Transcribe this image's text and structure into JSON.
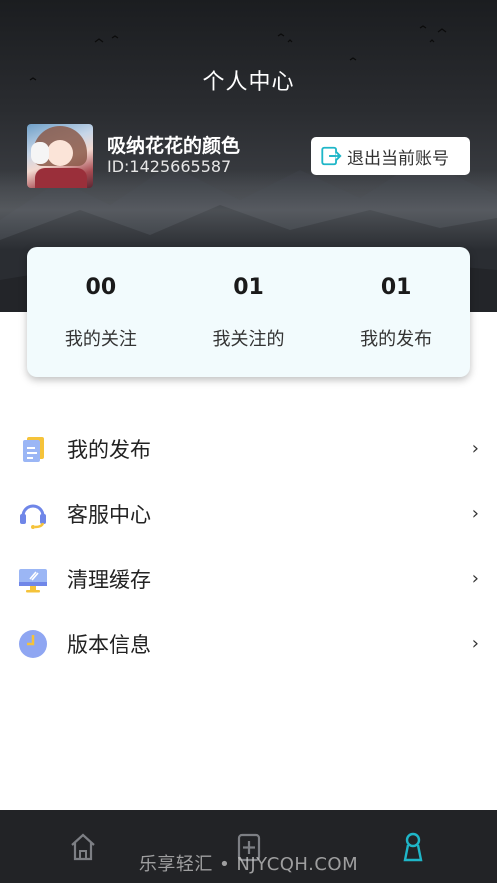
{
  "header": {
    "title": "个人中心"
  },
  "profile": {
    "username": "吸纳花花的颜色",
    "user_id": "ID:1425665587",
    "avatar_icon": "anime-avatar"
  },
  "logout": {
    "label": "退出当前账号",
    "icon": "logout-icon",
    "accent": "#1fb6c8"
  },
  "stats": [
    {
      "value": "00",
      "label": "我的关注"
    },
    {
      "value": "01",
      "label": "我关注的"
    },
    {
      "value": "01",
      "label": "我的发布"
    }
  ],
  "menu": [
    {
      "label": "我的发布",
      "icon": "document-icon"
    },
    {
      "label": "客服中心",
      "icon": "headset-icon"
    },
    {
      "label": "清理缓存",
      "icon": "monitor-icon"
    },
    {
      "label": "版本信息",
      "icon": "clock-icon"
    }
  ],
  "menu_chevron": "›",
  "tabbar": {
    "tabs": [
      {
        "name": "home-icon",
        "active": false
      },
      {
        "name": "add-icon",
        "active": false
      },
      {
        "name": "profile-icon",
        "active": true
      }
    ],
    "active_color": "#1fb6c8",
    "inactive_color": "#7d7f84"
  },
  "watermark": "乐享轻汇 • NJYCQH.COM"
}
